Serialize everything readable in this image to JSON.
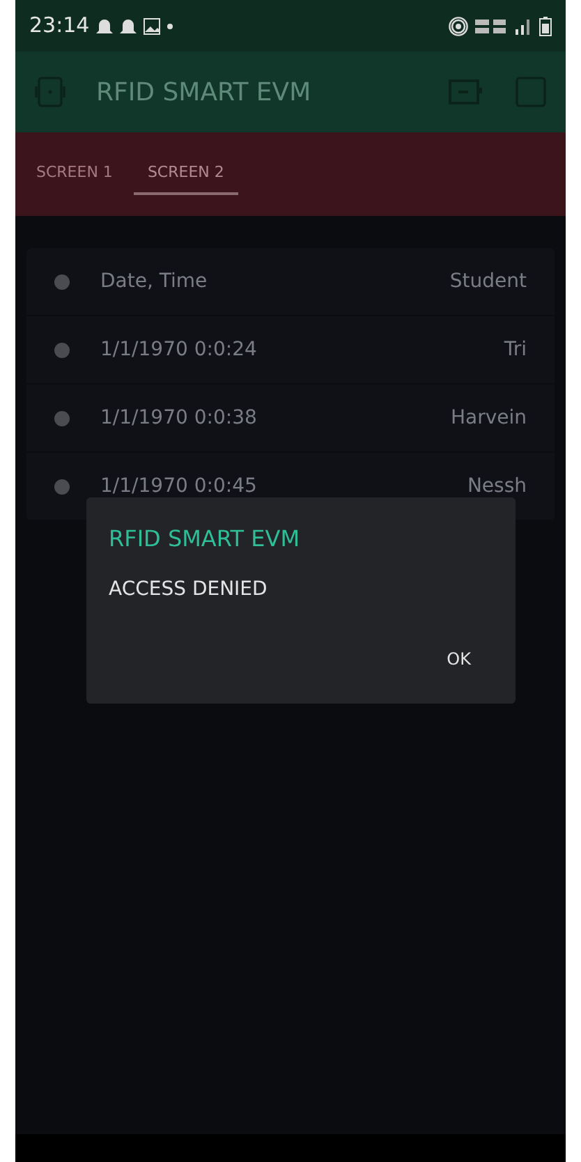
{
  "status_bar": {
    "time": "23:14"
  },
  "app_bar": {
    "title": "RFID SMART EVM"
  },
  "tabs": [
    {
      "label": "SCREEN 1",
      "selected": false
    },
    {
      "label": "SCREEN 2",
      "selected": true
    }
  ],
  "table": {
    "columns": [
      "Date, Time",
      "Student"
    ],
    "rows": [
      {
        "time": "1/1/1970 0:0:24",
        "student": "Tri"
      },
      {
        "time": "1/1/1970 0:0:38",
        "student": "Harvein"
      },
      {
        "time": "1/1/1970 0:0:45",
        "student": "Nessh"
      }
    ]
  },
  "dialog": {
    "title": "RFID SMART EVM",
    "message": "ACCESS DENIED",
    "button": "OK"
  }
}
